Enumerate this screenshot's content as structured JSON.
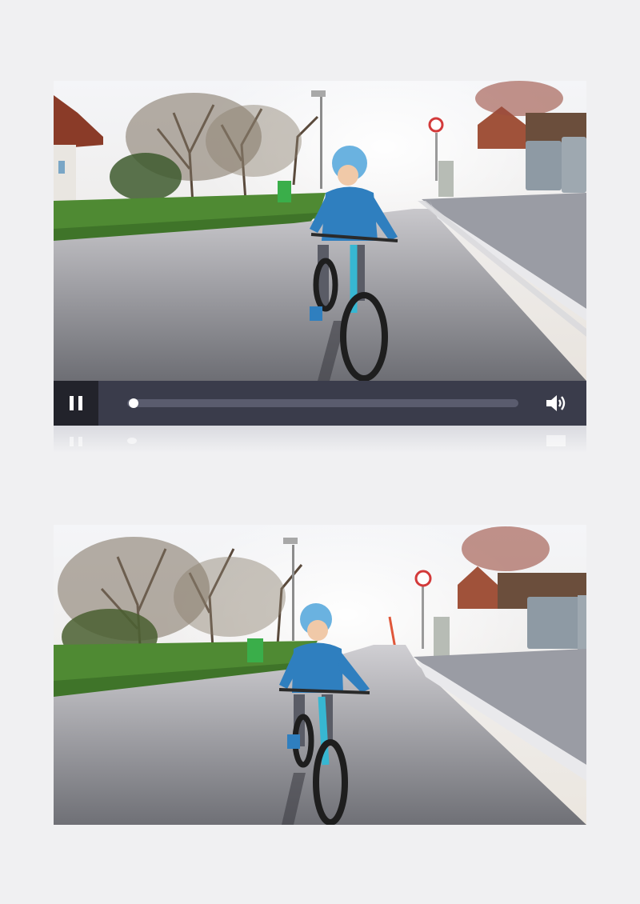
{
  "video_top": {
    "scene": "child-riding-bicycle",
    "player": {
      "state": "playing",
      "progress": 0.0,
      "pause_icon": "pause-icon",
      "volume_icon": "volume-icon"
    }
  },
  "video_bottom": {
    "scene": "child-riding-bicycle"
  },
  "colors": {
    "page_background": "#f0f0f2",
    "control_bar": "#3a3c4b",
    "play_button_bg": "#22232b",
    "track": "#5a5c6e",
    "thumb": "#ffffff"
  }
}
